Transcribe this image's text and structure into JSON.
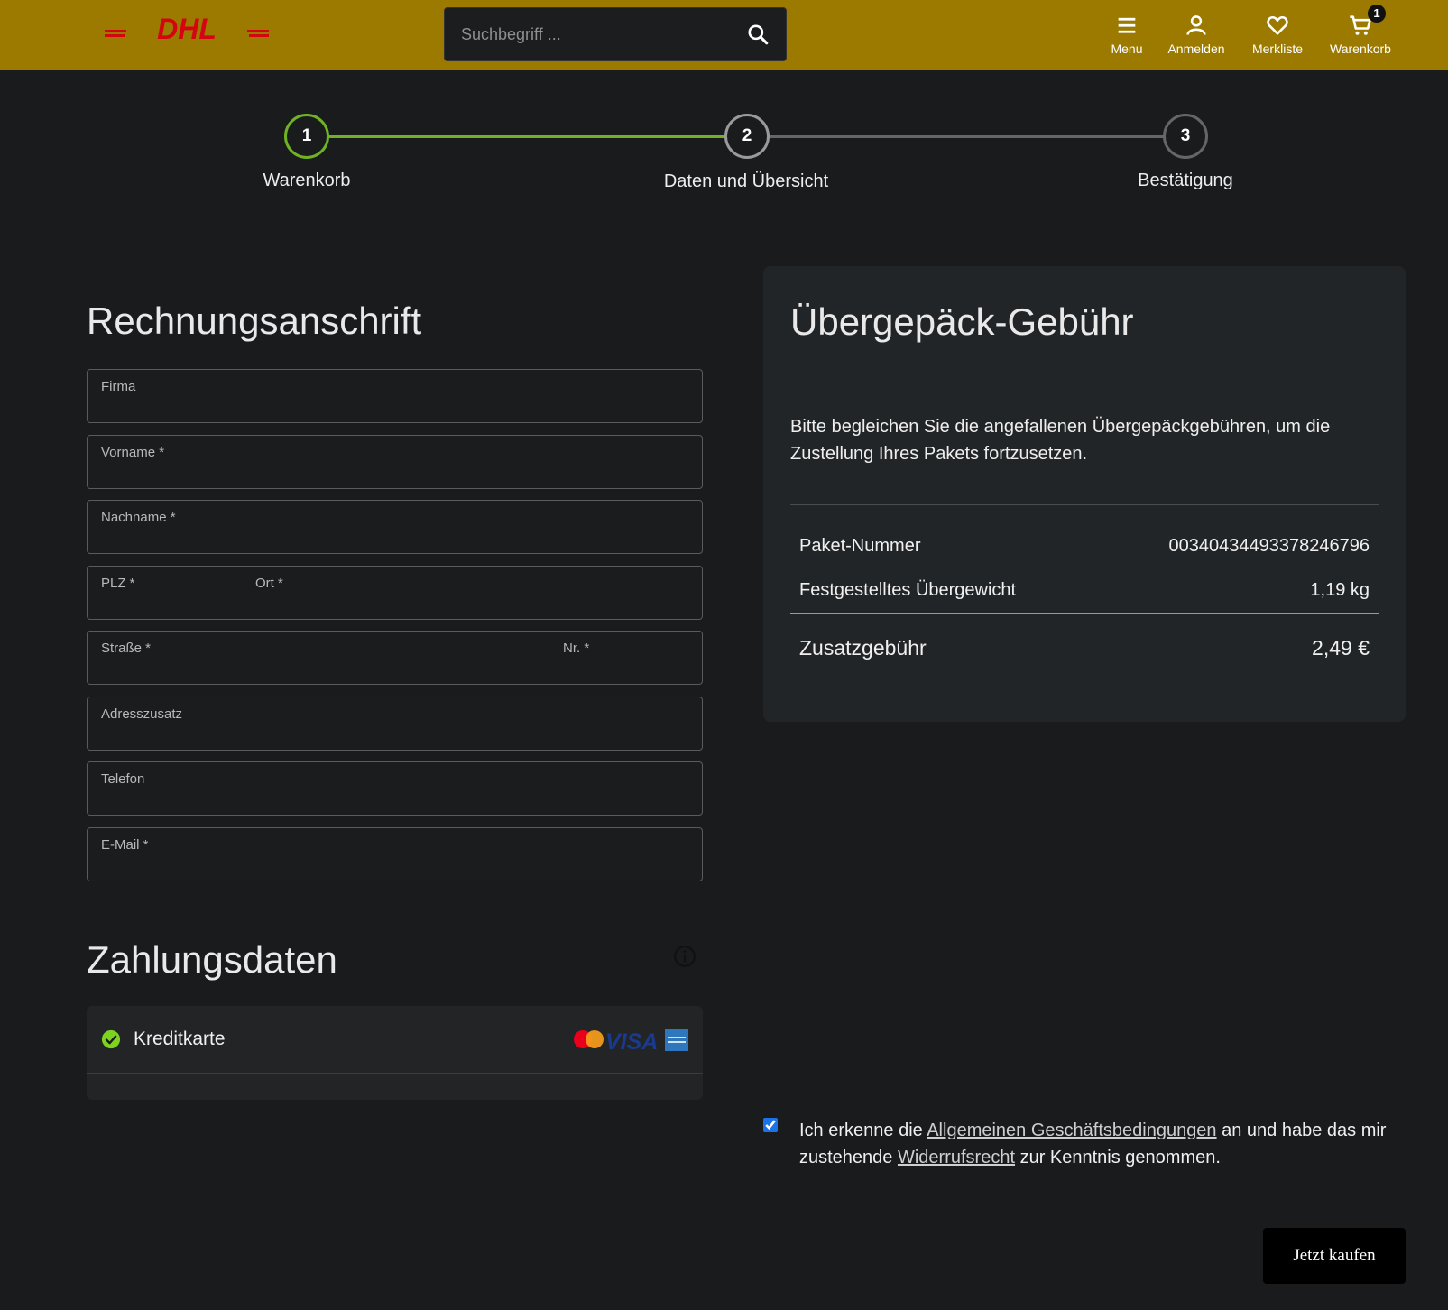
{
  "header": {
    "logo_text": "DHL",
    "search_placeholder": "Suchbegriff ...",
    "nav": [
      {
        "label": "Menu",
        "icon": "menu-icon"
      },
      {
        "label": "Anmelden",
        "icon": "user-icon"
      },
      {
        "label": "Merkliste",
        "icon": "heart-icon"
      },
      {
        "label": "Warenkorb",
        "icon": "cart-icon"
      }
    ],
    "cart_count": "1",
    "colors": {
      "bar": "#9c7a00",
      "logo": "#d40511"
    }
  },
  "stepper": {
    "steps": [
      {
        "number": "1",
        "label": "Warenkorb"
      },
      {
        "number": "2",
        "label": "Daten und Übersicht"
      },
      {
        "number": "3",
        "label": "Bestätigung"
      }
    ],
    "colors": {
      "done": "#6fb324",
      "pending": "#666666"
    }
  },
  "billing": {
    "title": "Rechnungsanschrift",
    "fields": {
      "firma": "Firma",
      "vorname": "Vorname  *",
      "nachname": "Nachname  *",
      "plz": "PLZ  *",
      "ort": "Ort  *",
      "strasse": "Straße  *",
      "nr": "Nr. *",
      "adresszusatz": "Adresszusatz",
      "telefon": "Telefon",
      "email": "E-Mail  *"
    }
  },
  "payment": {
    "title": "Zahlungsdaten",
    "method": "Kreditkarte",
    "cards": [
      "mastercard",
      "visa",
      "amex"
    ],
    "visa_text": "VISA"
  },
  "summary": {
    "title": "Übergepäck-Gebühr",
    "description": "Bitte begleichen Sie die angefallenen Übergepäckgebühren, um die Zustellung Ihres Pakets fortzusetzen.",
    "rows": [
      {
        "label": "Paket-Nummer",
        "value": "00340434493378246796"
      },
      {
        "label": "Festgestelltes Übergewicht",
        "value": "1,19 kg"
      }
    ],
    "total": {
      "label": "Zusatzgebühr",
      "value": "2,49 €"
    }
  },
  "terms": {
    "text_1": "Ich erkenne die ",
    "link_agb": "Allgemeinen Geschäftsbedingungen",
    "text_2": " an und habe das mir zustehende ",
    "link_widerruf": "Widerrufsrecht",
    "text_3": " zur Kenntnis genommen."
  },
  "buy_button": "Jetzt kaufen"
}
